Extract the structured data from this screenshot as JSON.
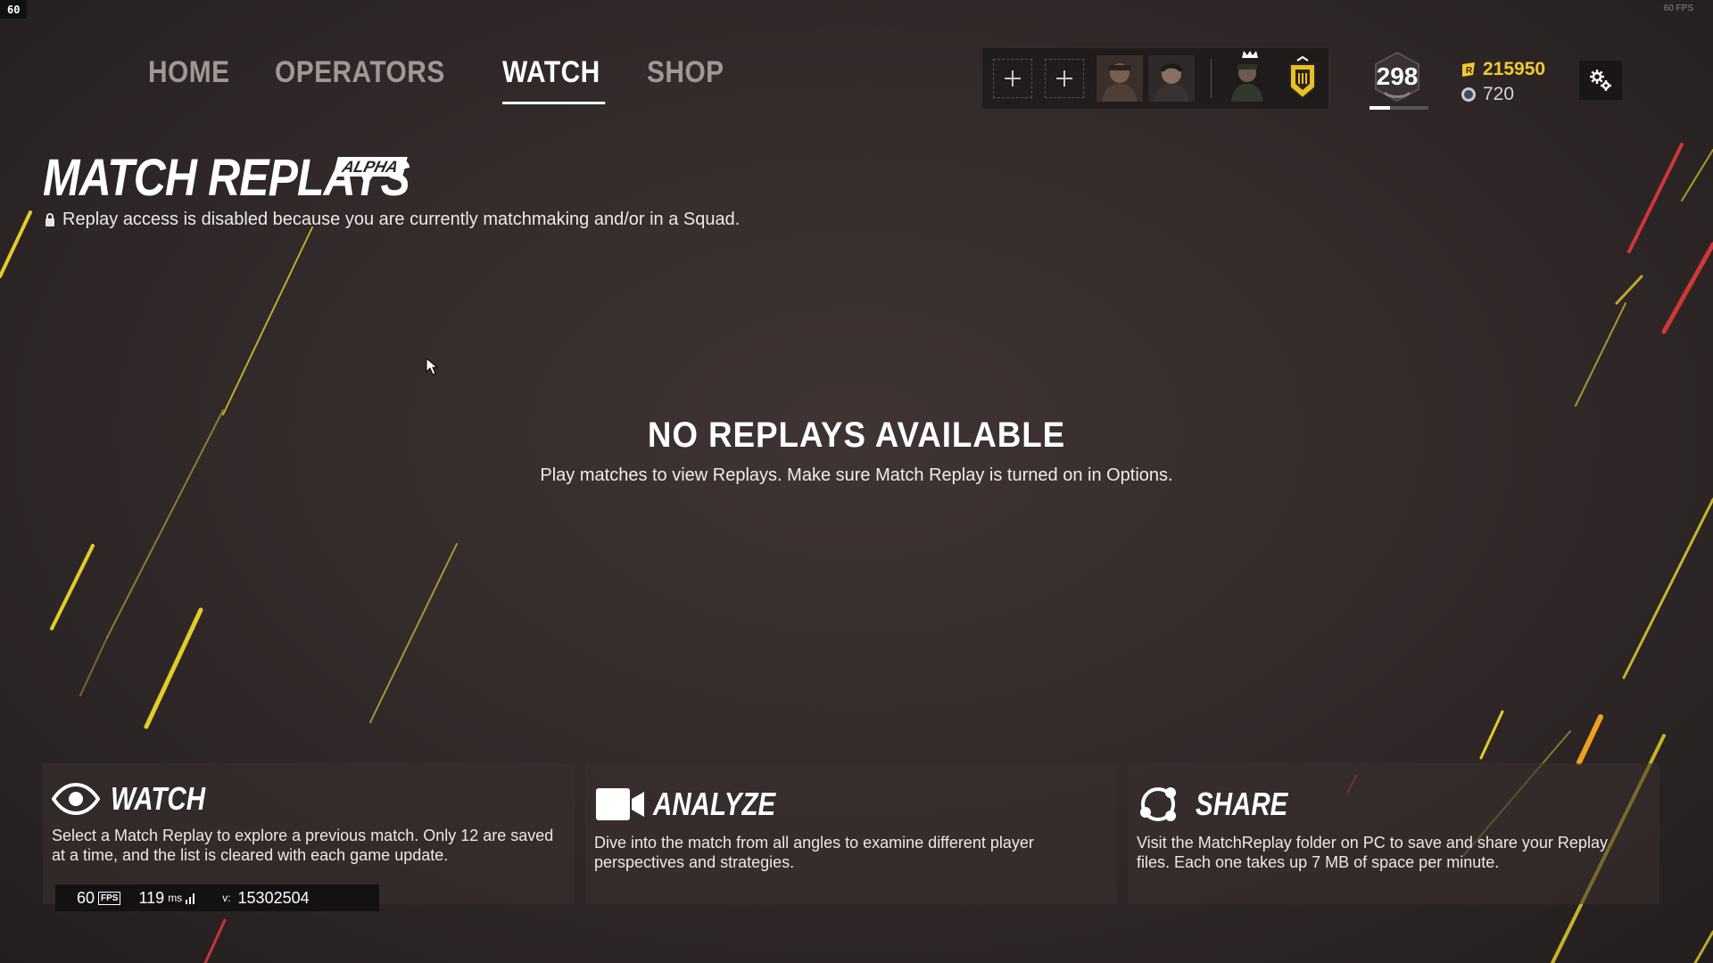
{
  "overlay": {
    "fps_corner": "60",
    "fps_tiny": "60 FPS"
  },
  "nav": {
    "items": [
      {
        "label": "HOME",
        "active": false
      },
      {
        "label": "OPERATORS",
        "active": false
      },
      {
        "label": "WATCH",
        "active": true
      },
      {
        "label": "SHOP",
        "active": false
      }
    ]
  },
  "squad": {
    "add_slot_icon": "plus-icon",
    "members": [
      "operator-portrait",
      "operator-portrait",
      "operator-portrait"
    ],
    "badge_icon": "rank-shield-icon"
  },
  "profile": {
    "level": "298",
    "level_progress": 0.35
  },
  "currency": {
    "renown": "215950",
    "r6_credits": "720",
    "renown_color": "#f2c833"
  },
  "header": {
    "title": "MATCH REPLAYS",
    "badge": "ALPHA",
    "notice": "Replay access is disabled because you are currently matchmaking and/or in a Squad."
  },
  "empty_state": {
    "title": "NO REPLAYS AVAILABLE",
    "subtitle": "Play matches to view Replays. Make sure Match Replay is turned on in Options."
  },
  "cards": [
    {
      "icon": "eye-icon",
      "title": "WATCH",
      "desc": "Select a Match Replay to explore a previous match. Only 12 are saved at a time, and the list is cleared with each game update."
    },
    {
      "icon": "video-camera-icon",
      "title": "ANALYZE",
      "desc": "Dive into the match from all angles to examine different player perspectives and strategies."
    },
    {
      "icon": "share-icon",
      "title": "SHARE",
      "desc": "Visit the MatchReplay folder on PC to save and share your Replay files. Each one takes up 7 MB of space per minute."
    }
  ],
  "perf": {
    "fps": "60",
    "fps_label": "FPS",
    "ping": "119",
    "ping_unit": "ms",
    "version_label": "v:",
    "version": "15302504"
  },
  "colors": {
    "accent": "#ffffff",
    "streak_yellow": "#e2cc2a",
    "streak_red": "#e23a3a",
    "background": "#342b2b"
  }
}
